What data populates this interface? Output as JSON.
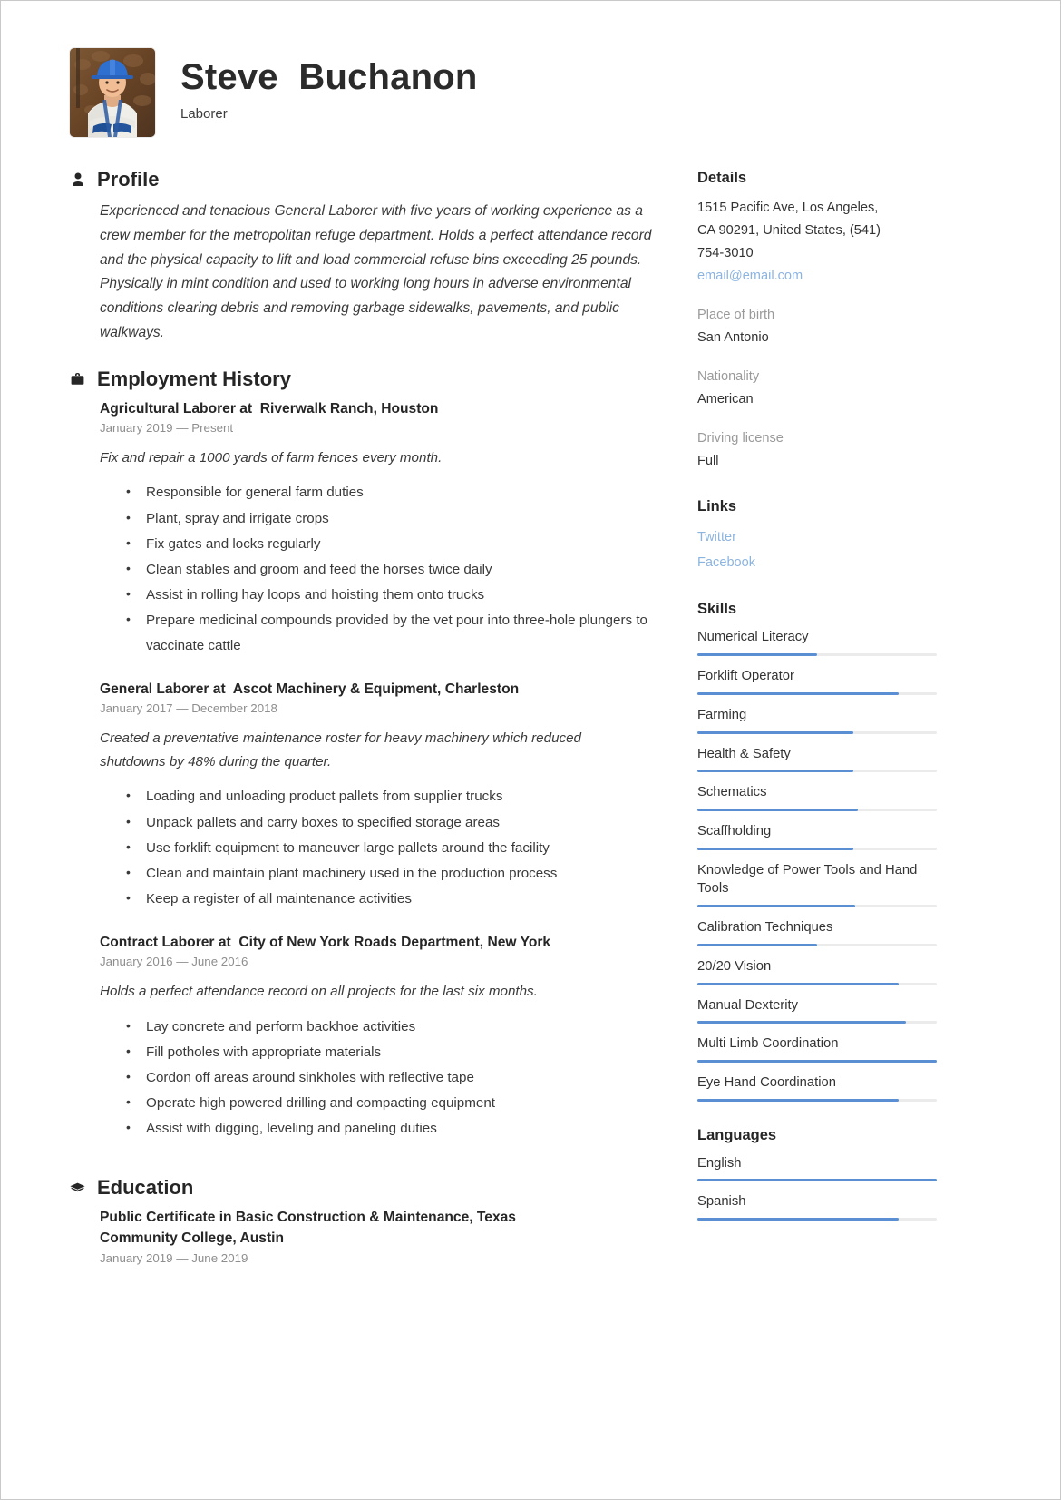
{
  "header": {
    "name": "Steve  Buchanon",
    "job_title": "Laborer",
    "avatar_alt": "portrait-photo-of-worker-in-blue-hard-hat"
  },
  "sections": {
    "profile_title": "Profile",
    "profile_icon": "person-icon",
    "employment_title": "Employment History",
    "employment_icon": "briefcase-icon",
    "education_title": "Education",
    "education_icon": "graduation-cap-icon"
  },
  "profile": {
    "text": "Experienced and tenacious General Laborer with five years of working experience as a crew member for the metropolitan refuge department. Holds a perfect attendance record and the physical capacity to lift and load commercial refuse bins exceeding 25 pounds. Physically in mint condition and used to working long hours in adverse environmental conditions clearing debris and removing garbage sidewalks, pavements, and public walkways."
  },
  "employment": [
    {
      "title": "Agricultural Laborer at  Riverwalk Ranch, Houston",
      "dates": "January 2019 — Present",
      "summary": "Fix and repair a 1000 yards of farm fences every month.",
      "bullets": [
        "Responsible for general farm duties",
        "Plant, spray and irrigate crops",
        "Fix gates and locks regularly",
        "Clean stables and groom and feed the horses twice daily",
        "Assist in rolling hay loops and hoisting them onto trucks",
        "Prepare  medicinal compounds provided by the vet pour into three-hole plungers to    vaccinate cattle"
      ]
    },
    {
      "title": "General Laborer at  Ascot Machinery & Equipment, Charleston",
      "dates": "January 2017 — December 2018",
      "summary": "Created a preventative maintenance roster for heavy machinery which reduced shutdowns by 48% during the quarter.",
      "bullets": [
        "Loading and unloading product pallets from supplier trucks",
        "Unpack pallets  and carry boxes to specified storage areas",
        "Use forklift equipment to maneuver large pallets around the facility",
        "Clean and maintain plant machinery used in the production process",
        "Keep a register of all maintenance activities"
      ]
    },
    {
      "title": "Contract Laborer at  City of New York Roads Department, New York",
      "dates": "January 2016 — June 2016",
      "summary": "Holds a perfect attendance record on all projects for the last six months.",
      "bullets": [
        "Lay concrete and perform backhoe activities",
        "Fill potholes with appropriate materials",
        "Cordon off areas around sinkholes with reflective tape",
        "Operate high powered drilling and compacting equipment",
        "Assist with digging, leveling and paneling duties"
      ]
    }
  ],
  "education": [
    {
      "title": "Public Certificate in Basic Construction & Maintenance, Texas Community College, Austin",
      "dates": "January 2019 — June 2019"
    }
  ],
  "details": {
    "heading": "Details",
    "address_line_1": "1515 Pacific Ave, Los Angeles,",
    "address_line_2": "CA 90291, United States, (541)",
    "address_line_3": "754-3010",
    "email": "email@email.com",
    "fields": [
      {
        "label": "Place of birth",
        "value": "San Antonio"
      },
      {
        "label": "Nationality",
        "value": "American"
      },
      {
        "label": "Driving license",
        "value": "Full"
      }
    ]
  },
  "links": {
    "heading": "Links",
    "items": [
      {
        "label": "Twitter"
      },
      {
        "label": "Facebook"
      }
    ]
  },
  "skills": {
    "heading": "Skills",
    "items": [
      {
        "name": "Numerical Literacy",
        "level": 50
      },
      {
        "name": "Forklift Operator",
        "level": 84
      },
      {
        "name": "Farming",
        "level": 65
      },
      {
        "name": "Health & Safety",
        "level": 65
      },
      {
        "name": "Schematics",
        "level": 67
      },
      {
        "name": "Scaffholding",
        "level": 65
      },
      {
        "name": "Knowledge of Power Tools and Hand Tools",
        "level": 66
      },
      {
        "name": "Calibration Techniques",
        "level": 50
      },
      {
        "name": "20/20 Vision",
        "level": 84
      },
      {
        "name": "Manual Dexterity",
        "level": 87
      },
      {
        "name": "Multi Limb Coordination",
        "level": 100
      },
      {
        "name": "Eye Hand Coordination",
        "level": 84
      }
    ]
  },
  "languages": {
    "heading": "Languages",
    "items": [
      {
        "name": "English",
        "level": 100
      },
      {
        "name": "Spanish",
        "level": 84
      }
    ]
  },
  "colors": {
    "accent": "#5b8fd4",
    "link": "#8cb4e0",
    "track": "#ebebeb",
    "text": "#333333",
    "muted": "#8e8e8e"
  }
}
